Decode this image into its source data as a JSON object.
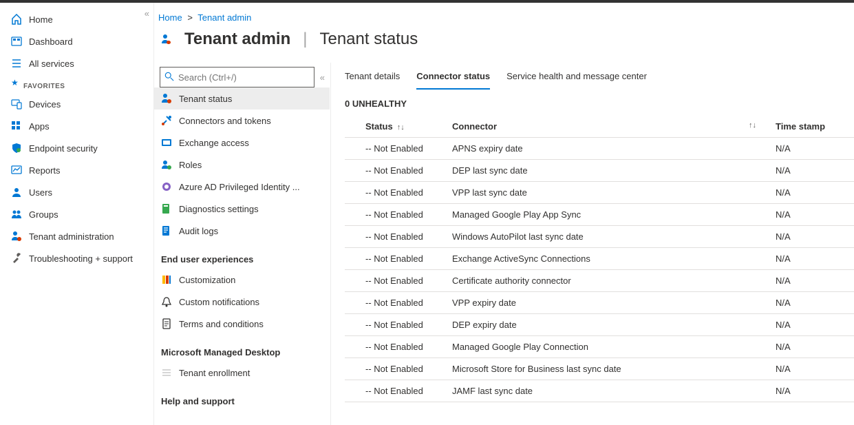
{
  "breadcrumb": {
    "home": "Home",
    "tenant_admin": "Tenant admin",
    "sep": ">"
  },
  "title": {
    "strong": "Tenant admin",
    "sub": "Tenant status"
  },
  "leftnav": {
    "items": [
      {
        "label": "Home"
      },
      {
        "label": "Dashboard"
      },
      {
        "label": "All services"
      }
    ],
    "favorites_label": "FAVORITES",
    "favorites": [
      {
        "label": "Devices"
      },
      {
        "label": "Apps"
      },
      {
        "label": "Endpoint security"
      },
      {
        "label": "Reports"
      },
      {
        "label": "Users"
      },
      {
        "label": "Groups"
      },
      {
        "label": "Tenant administration"
      },
      {
        "label": "Troubleshooting + support"
      }
    ]
  },
  "search": {
    "placeholder": "Search (Ctrl+/)"
  },
  "subnav": {
    "items": [
      {
        "label": "Tenant status",
        "active": true
      },
      {
        "label": "Connectors and tokens"
      },
      {
        "label": "Exchange access"
      },
      {
        "label": "Roles"
      },
      {
        "label": "Azure AD Privileged Identity ..."
      },
      {
        "label": "Diagnostics settings"
      },
      {
        "label": "Audit logs"
      }
    ],
    "groups": [
      {
        "title": "End user experiences",
        "items": [
          {
            "label": "Customization"
          },
          {
            "label": "Custom notifications"
          },
          {
            "label": "Terms and conditions"
          }
        ]
      },
      {
        "title": "Microsoft Managed Desktop",
        "items": [
          {
            "label": "Tenant enrollment"
          }
        ]
      },
      {
        "title": "Help and support",
        "items": []
      }
    ]
  },
  "tabs": [
    {
      "label": "Tenant details"
    },
    {
      "label": "Connector status",
      "active": true
    },
    {
      "label": "Service health and message center"
    }
  ],
  "unhealthy": "0 UNHEALTHY",
  "table": {
    "headers": {
      "status": "Status",
      "connector": "Connector",
      "timestamp": "Time stamp"
    },
    "rows": [
      {
        "status": "-- Not Enabled",
        "connector": "APNS expiry date",
        "ts": "N/A"
      },
      {
        "status": "-- Not Enabled",
        "connector": "DEP last sync date",
        "ts": "N/A"
      },
      {
        "status": "-- Not Enabled",
        "connector": "VPP last sync date",
        "ts": "N/A"
      },
      {
        "status": "-- Not Enabled",
        "connector": "Managed Google Play App Sync",
        "ts": "N/A"
      },
      {
        "status": "-- Not Enabled",
        "connector": "Windows AutoPilot last sync date",
        "ts": "N/A"
      },
      {
        "status": "-- Not Enabled",
        "connector": "Exchange ActiveSync Connections",
        "ts": "N/A"
      },
      {
        "status": "-- Not Enabled",
        "connector": "Certificate authority connector",
        "ts": "N/A"
      },
      {
        "status": "-- Not Enabled",
        "connector": "VPP expiry date",
        "ts": "N/A"
      },
      {
        "status": "-- Not Enabled",
        "connector": "DEP expiry date",
        "ts": "N/A"
      },
      {
        "status": "-- Not Enabled",
        "connector": "Managed Google Play Connection",
        "ts": "N/A"
      },
      {
        "status": "-- Not Enabled",
        "connector": "Microsoft Store for Business last sync date",
        "ts": "N/A"
      },
      {
        "status": "-- Not Enabled",
        "connector": "JAMF last sync date",
        "ts": "N/A"
      }
    ]
  }
}
